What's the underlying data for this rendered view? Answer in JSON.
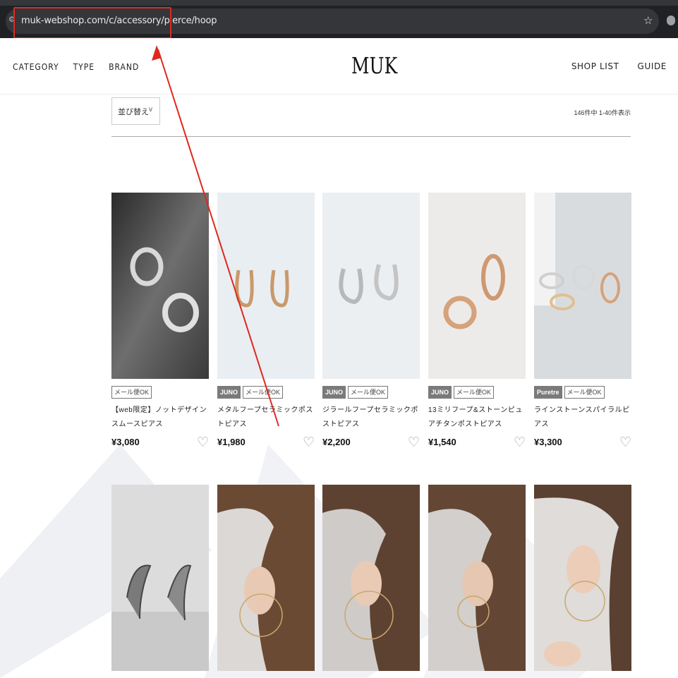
{
  "browser": {
    "url": "muk-webshop.com/c/accessory/pierce/hoop",
    "site_info_icon": "tune-icon",
    "bookmark_icon": "star-icon"
  },
  "header": {
    "nav_left": [
      "CATEGORY",
      "TYPE",
      "BRAND"
    ],
    "logo": "MUK",
    "nav_right": [
      "SHOP LIST",
      "GUIDE"
    ]
  },
  "toolbar": {
    "sort_label": "並び替え",
    "sort_chevron": "v",
    "result_count": "146件中 1-40件表示"
  },
  "products": [
    {
      "tags": [
        {
          "type": "mail",
          "label": "メール便OK"
        }
      ],
      "name": "【web限定】ノットデザインスムースピアス",
      "price": "¥3,080"
    },
    {
      "tags": [
        {
          "type": "brand",
          "label": "JUNO"
        },
        {
          "type": "mail",
          "label": "メール便OK"
        }
      ],
      "name": "メタルフープセラミックポストピアス",
      "price": "¥1,980"
    },
    {
      "tags": [
        {
          "type": "brand",
          "label": "JUNO"
        },
        {
          "type": "mail",
          "label": "メール便OK"
        }
      ],
      "name": "ジラールフープセラミックポストピアス",
      "price": "¥2,200"
    },
    {
      "tags": [
        {
          "type": "brand",
          "label": "JUNO"
        },
        {
          "type": "mail",
          "label": "メール便OK"
        }
      ],
      "name": "13ミリフープ&ストーンピュアチタンポストピアス",
      "price": "¥1,540"
    },
    {
      "tags": [
        {
          "type": "brand",
          "label": "Puretre"
        },
        {
          "type": "mail",
          "label": "メール便OK"
        }
      ],
      "name": "ラインストーンスパイラルピアス",
      "price": "¥3,300"
    }
  ],
  "colors": {
    "highlight": "#e0281e",
    "tag_brand_bg": "#7a7a7a"
  }
}
